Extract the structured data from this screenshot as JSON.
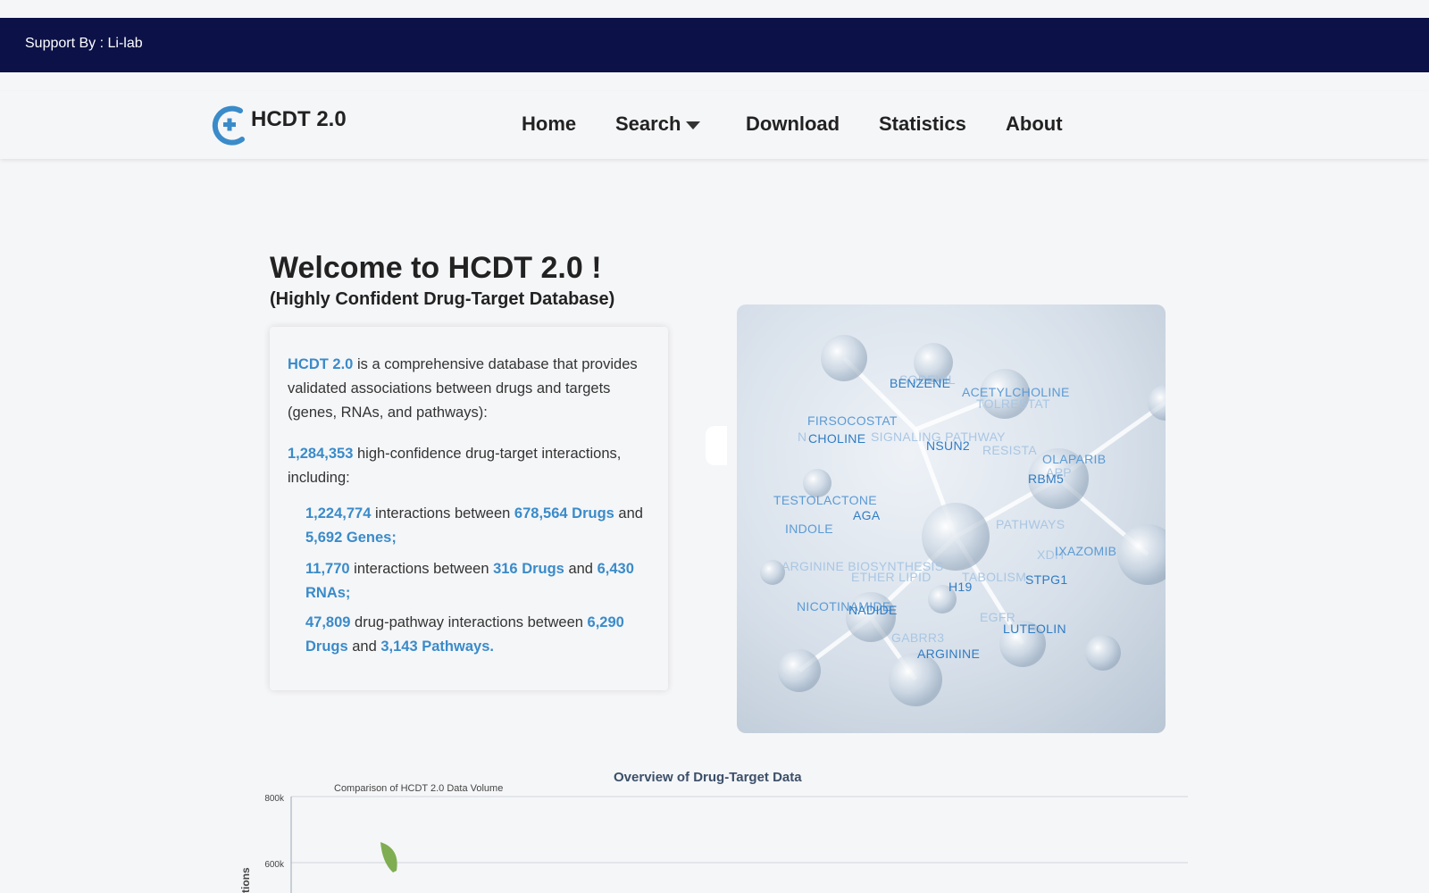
{
  "support": {
    "text": "Support By : Li-lab"
  },
  "brand": {
    "name": "HCDT 2.0"
  },
  "nav": {
    "home": "Home",
    "search": "Search",
    "download": "Download",
    "statistics": "Statistics",
    "about": "About"
  },
  "welcome": {
    "title": "Welcome to HCDT 2.0 !",
    "subtitle": "(Highly Confident Drug-Target Database)"
  },
  "intro": {
    "name": "HCDT 2.0",
    "desc": " is a comprehensive database that provides validated associations between drugs and targets (genes, RNAs, and pathways):",
    "total": "1,284,353",
    "total_text": " high-confidence drug-target interactions, including:",
    "genes_count": "1,224,774",
    "genes_mid": " interactions between ",
    "genes_drugs": "678,564 Drugs",
    "genes_and": " and ",
    "genes_targets": "5,692 Genes;",
    "rnas_count": "11,770",
    "rnas_mid": " interactions between ",
    "rnas_drugs": "316 Drugs",
    "rnas_and": " and ",
    "rnas_targets": "6,430 RNAs;",
    "path_count": "47,809",
    "path_mid": " drug-pathway interactions between ",
    "path_drugs": "6,290 Drugs",
    "path_and": " and ",
    "path_targets": "3,143 Pathways."
  },
  "word_cloud": [
    {
      "t": "SODEVIL",
      "c": "light"
    },
    {
      "t": "BENZENE",
      "c": "dark"
    },
    {
      "t": "ACETYLCHOLINE",
      "c": "mid"
    },
    {
      "t": "TOLRESTAT",
      "c": "light"
    },
    {
      "t": "FIRSOCOSTAT",
      "c": "mid"
    },
    {
      "t": "N",
      "c": "light"
    },
    {
      "t": "CHOLINE",
      "c": "dark"
    },
    {
      "t": "SIGNALING PATHWAY",
      "c": "light"
    },
    {
      "t": "NSUN2",
      "c": "dark"
    },
    {
      "t": "RESISTA",
      "c": "light"
    },
    {
      "t": "OLAPARIB",
      "c": "mid"
    },
    {
      "t": "APP",
      "c": "light"
    },
    {
      "t": "RBM5",
      "c": "dark"
    },
    {
      "t": "TESTOLACTONE",
      "c": "mid"
    },
    {
      "t": "AGA",
      "c": "dark"
    },
    {
      "t": "INDOLE",
      "c": "mid"
    },
    {
      "t": "PATHWAYS",
      "c": "light"
    },
    {
      "t": "XDH",
      "c": "light"
    },
    {
      "t": "IXAZOMIB",
      "c": "mid"
    },
    {
      "t": "ARGININE BIOSYNTHESIS",
      "c": "light"
    },
    {
      "t": "ETHER LIPID",
      "c": "light"
    },
    {
      "t": "TABOLISM",
      "c": "light"
    },
    {
      "t": "STPG1",
      "c": "dark"
    },
    {
      "t": "H19",
      "c": "dark"
    },
    {
      "t": "NICOTINAMIDE",
      "c": "mid"
    },
    {
      "t": "NADIDE",
      "c": "dark"
    },
    {
      "t": "EGFR",
      "c": "light"
    },
    {
      "t": "LUTEOLIN",
      "c": "dark"
    },
    {
      "t": "GABRR3",
      "c": "light"
    },
    {
      "t": "ARGININE",
      "c": "dark"
    }
  ],
  "overview": {
    "title": "Overview of Drug-Target Data",
    "subtitle": "Comparison of HCDT 2.0 Data Volume"
  },
  "chart_data": {
    "type": "bar",
    "title": "Comparison of HCDT 2.0 Data Volume",
    "ylabel": "tions",
    "yticks": [
      "800k",
      "600k"
    ],
    "ylim": [
      500000,
      800000
    ],
    "grid": true
  },
  "colors": {
    "support_bar": "#0c1147",
    "accent": "#3a8bc9",
    "leaf": "#7fad52"
  }
}
